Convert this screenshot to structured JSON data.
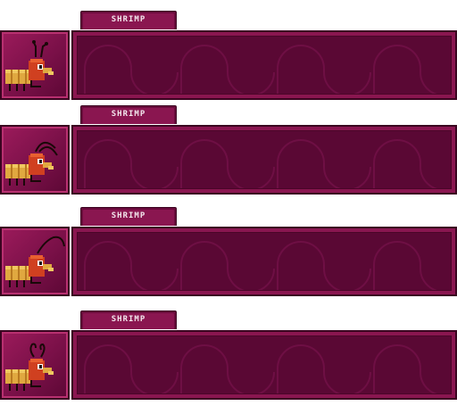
{
  "panels": [
    {
      "label": "SHRIMP",
      "pose": "antennae-up"
    },
    {
      "label": "SHRIMP",
      "pose": "antennae-back"
    },
    {
      "label": "SHRIMP",
      "pose": "antenna-long"
    },
    {
      "label": "SHRIMP",
      "pose": "antennae-curled"
    }
  ],
  "colors": {
    "frame": "#3a0420",
    "panel": "#8a1650",
    "field": "#5a0834",
    "wave": "#6e0f44",
    "label": "#f4e8ee",
    "shrimp_body": "#e0a840",
    "shrimp_head": "#d04020"
  }
}
